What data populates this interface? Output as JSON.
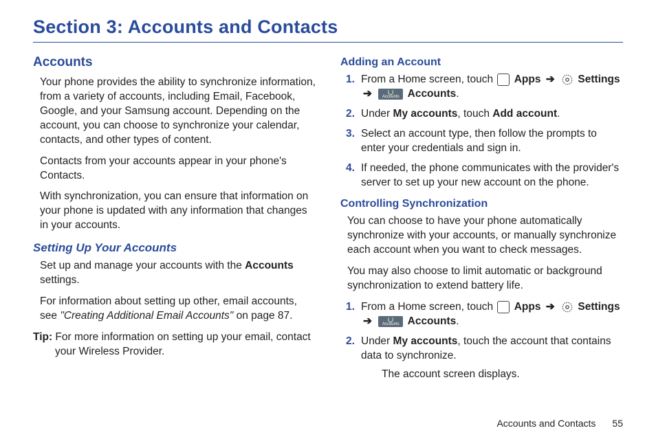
{
  "section_title": "Section 3: Accounts and Contacts",
  "left": {
    "heading": "Accounts",
    "p1": "Your phone provides the ability to synchronize information, from a variety of accounts, including Email, Facebook, Google, and your Samsung account. Depending on the account, you can choose to synchronize your calendar, contacts, and other types of content.",
    "p2": "Contacts from your accounts appear in your phone's Contacts.",
    "p3": "With synchronization, you can ensure that information on your phone is updated with any information that changes in your accounts.",
    "sub1": "Setting Up Your Accounts",
    "p4a": "Set up and manage your accounts with the ",
    "p4b": "Accounts",
    "p4c": " settings.",
    "p5a": "For information about setting up other, email accounts, see ",
    "p5ref": "\"Creating Additional Email Accounts\"",
    "p5b": " on page 87.",
    "tip_label": "Tip:",
    "tip_body": " For more information on setting up your email, contact your Wireless Provider."
  },
  "right": {
    "sub1": "Adding an Account",
    "steps1": [
      {
        "num": "1.",
        "pre": "From a Home screen, touch ",
        "apps": "Apps",
        "settings": "Settings",
        "accounts": "Accounts",
        "tail": "."
      },
      {
        "num": "2.",
        "pre": "Under ",
        "bold1": "My accounts",
        "mid": ", touch ",
        "bold2": "Add account",
        "tail": "."
      },
      {
        "num": "3.",
        "text": "Select an account type, then follow the prompts to enter your credentials and sign in."
      },
      {
        "num": "4.",
        "text": "If needed, the phone communicates with the provider's server to set up your new account on the phone."
      }
    ],
    "sub2": "Controlling Synchronization",
    "p1": "You can choose to have your phone automatically synchronize with your accounts, or manually synchronize each account when you want to check messages.",
    "p2": "You may also choose to limit automatic or background synchronization to extend battery life.",
    "steps2": [
      {
        "num": "1.",
        "pre": "From a Home screen, touch ",
        "apps": "Apps",
        "settings": "Settings",
        "accounts": "Accounts",
        "tail": "."
      },
      {
        "num": "2.",
        "pre": "Under ",
        "bold1": "My accounts",
        "mid": ", touch the account that contains data to synchronize.",
        "after": "The account screen displays."
      }
    ]
  },
  "footer": {
    "section": "Accounts and Contacts",
    "page": "55"
  },
  "icons": {
    "accounts_label": "Accounts"
  }
}
